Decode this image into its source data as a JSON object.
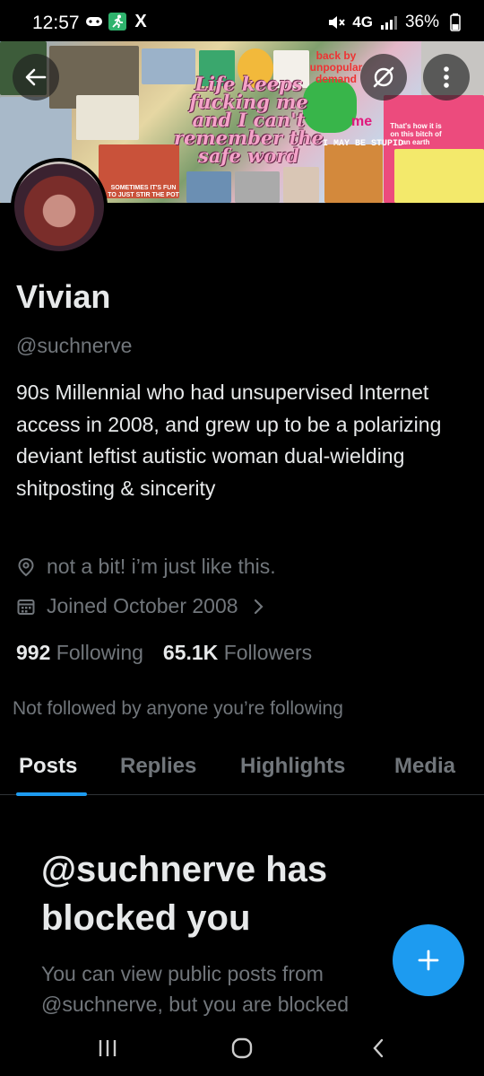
{
  "status_bar": {
    "time": "12:57",
    "network": "4G",
    "battery": "36%",
    "x_logo": "X"
  },
  "header": {
    "banner": {
      "main_text": "Life keeps fucking me and I can't remember the safe word",
      "back_text": "back by unpopular demand",
      "me_text": "me",
      "stupid_text": "I MAY BE STUPID",
      "sometimes_text": "SOMETIMES IT'S FUN TO JUST STIR THE POT",
      "thats_text": "That's how it is on this bitch of an earth"
    }
  },
  "profile": {
    "name": "Vivian",
    "handle": "@suchnerve",
    "bio": "90s Millennial who had unsupervised Internet access in 2008, and grew up to be a polarizing deviant leftist autistic woman dual-wielding shitposting & sincerity",
    "location": "not a bit! i’m just like this.",
    "joined": "Joined October 2008",
    "following_count": "992",
    "following_label": "Following",
    "followers_count": "65.1K",
    "followers_label": "Followers",
    "not_followed": "Not followed by anyone you’re following"
  },
  "tabs": [
    {
      "label": "Posts",
      "active": true
    },
    {
      "label": "Replies",
      "active": false
    },
    {
      "label": "Highlights",
      "active": false
    },
    {
      "label": "Media",
      "active": false
    }
  ],
  "blocked": {
    "title": "@suchnerve has blocked you",
    "description": "You can view public posts from @suchnerve, but you are blocked"
  },
  "colors": {
    "accent": "#1d9bf0",
    "background": "#000000",
    "text_primary": "#e7e9ea",
    "text_secondary": "#71767b"
  },
  "icons": {
    "back": "arrow-left-icon",
    "grok": "grok-icon",
    "more": "more-vertical-icon",
    "location": "location-pin-icon",
    "calendar": "calendar-icon",
    "chevron": "chevron-right-icon",
    "compose": "plus-icon"
  }
}
